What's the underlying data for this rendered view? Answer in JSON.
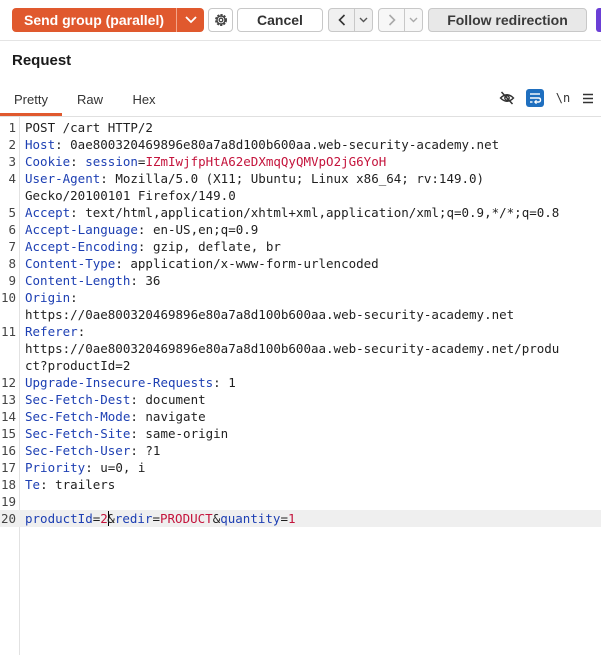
{
  "toolbar": {
    "send_label": "Send group (parallel)",
    "cancel_label": "Cancel",
    "follow_label": "Follow redirection"
  },
  "panel": {
    "title": "Request",
    "tabs": [
      "Pretty",
      "Raw",
      "Hex"
    ],
    "active_tab": "Pretty",
    "newline_toggle": "\\n"
  },
  "editor": {
    "lines": [
      {
        "n": "1",
        "parts": [
          {
            "t": "POST /cart HTTP/2",
            "c": "v"
          }
        ]
      },
      {
        "n": "2",
        "parts": [
          {
            "t": "Host",
            "c": "k"
          },
          {
            "t": ": 0ae800320469896e80a7a8d100b600aa.web-security-academy.net",
            "c": "v"
          }
        ]
      },
      {
        "n": "3",
        "parts": [
          {
            "t": "Cookie",
            "c": "k"
          },
          {
            "t": ": ",
            "c": "v"
          },
          {
            "t": "session",
            "c": "k"
          },
          {
            "t": "=",
            "c": "v"
          },
          {
            "t": "IZmIwjfpHtA62eDXmqQyQMVpO2jG6YoH",
            "c": "red"
          }
        ]
      },
      {
        "n": "4",
        "parts": [
          {
            "t": "User-Agent",
            "c": "k"
          },
          {
            "t": ": Mozilla/5.0 (X11; Ubuntu; Linux x86_64; rv:149.0)",
            "c": "v"
          }
        ]
      },
      {
        "n": "",
        "parts": [
          {
            "t": "Gecko/20100101 Firefox/149.0",
            "c": "v"
          }
        ]
      },
      {
        "n": "5",
        "parts": [
          {
            "t": "Accept",
            "c": "k"
          },
          {
            "t": ": text/html,application/xhtml+xml,application/xml;q=0.9,*/*;q=0.8",
            "c": "v"
          }
        ]
      },
      {
        "n": "6",
        "parts": [
          {
            "t": "Accept-Language",
            "c": "k"
          },
          {
            "t": ": en-US,en;q=0.9",
            "c": "v"
          }
        ]
      },
      {
        "n": "7",
        "parts": [
          {
            "t": "Accept-Encoding",
            "c": "k"
          },
          {
            "t": ": gzip, deflate, br",
            "c": "v"
          }
        ]
      },
      {
        "n": "8",
        "parts": [
          {
            "t": "Content-Type",
            "c": "k"
          },
          {
            "t": ": application/x-www-form-urlencoded",
            "c": "v"
          }
        ]
      },
      {
        "n": "9",
        "parts": [
          {
            "t": "Content-Length",
            "c": "k"
          },
          {
            "t": ": 36",
            "c": "v"
          }
        ]
      },
      {
        "n": "10",
        "parts": [
          {
            "t": "Origin",
            "c": "k"
          },
          {
            "t": ":",
            "c": "v"
          }
        ]
      },
      {
        "n": "",
        "parts": [
          {
            "t": "https://0ae800320469896e80a7a8d100b600aa.web-security-academy.net",
            "c": "v"
          }
        ]
      },
      {
        "n": "11",
        "parts": [
          {
            "t": "Referer",
            "c": "k"
          },
          {
            "t": ":",
            "c": "v"
          }
        ]
      },
      {
        "n": "",
        "parts": [
          {
            "t": "https://0ae800320469896e80a7a8d100b600aa.web-security-academy.net/produ",
            "c": "v"
          }
        ]
      },
      {
        "n": "",
        "parts": [
          {
            "t": "ct?productId=2",
            "c": "v"
          }
        ]
      },
      {
        "n": "12",
        "parts": [
          {
            "t": "Upgrade-Insecure-Requests",
            "c": "k"
          },
          {
            "t": ": 1",
            "c": "v"
          }
        ]
      },
      {
        "n": "13",
        "parts": [
          {
            "t": "Sec-Fetch-Dest",
            "c": "k"
          },
          {
            "t": ": document",
            "c": "v"
          }
        ]
      },
      {
        "n": "14",
        "parts": [
          {
            "t": "Sec-Fetch-Mode",
            "c": "k"
          },
          {
            "t": ": navigate",
            "c": "v"
          }
        ]
      },
      {
        "n": "15",
        "parts": [
          {
            "t": "Sec-Fetch-Site",
            "c": "k"
          },
          {
            "t": ": same-origin",
            "c": "v"
          }
        ]
      },
      {
        "n": "16",
        "parts": [
          {
            "t": "Sec-Fetch-User",
            "c": "k"
          },
          {
            "t": ": ?1",
            "c": "v"
          }
        ]
      },
      {
        "n": "17",
        "parts": [
          {
            "t": "Priority",
            "c": "k"
          },
          {
            "t": ": u=0, i",
            "c": "v"
          }
        ]
      },
      {
        "n": "18",
        "parts": [
          {
            "t": "Te",
            "c": "k"
          },
          {
            "t": ": trailers",
            "c": "v"
          }
        ]
      },
      {
        "n": "19",
        "parts": []
      },
      {
        "n": "20",
        "active": true,
        "parts": [
          {
            "t": "productId",
            "c": "k"
          },
          {
            "t": "=",
            "c": "v"
          },
          {
            "t": "2",
            "c": "red"
          },
          {
            "t": "|",
            "c": "cursor"
          },
          {
            "t": "&",
            "c": "v"
          },
          {
            "t": "redir",
            "c": "k"
          },
          {
            "t": "=",
            "c": "v"
          },
          {
            "t": "PRODUCT",
            "c": "red"
          },
          {
            "t": "&",
            "c": "v"
          },
          {
            "t": "quantity",
            "c": "k"
          },
          {
            "t": "=",
            "c": "v"
          },
          {
            "t": "1",
            "c": "red"
          }
        ]
      }
    ]
  },
  "colors": {
    "accent": "#e0592e",
    "header_name": "#1d3fb3",
    "value_red": "#c4143c",
    "wrap_toggle_active": "#1f6fbf"
  },
  "icons": [
    "gear-icon",
    "chevron-down-icon",
    "chevron-left-icon",
    "chevron-right-icon",
    "eye-off-icon",
    "wrap-lines-icon",
    "menu-icon"
  ]
}
